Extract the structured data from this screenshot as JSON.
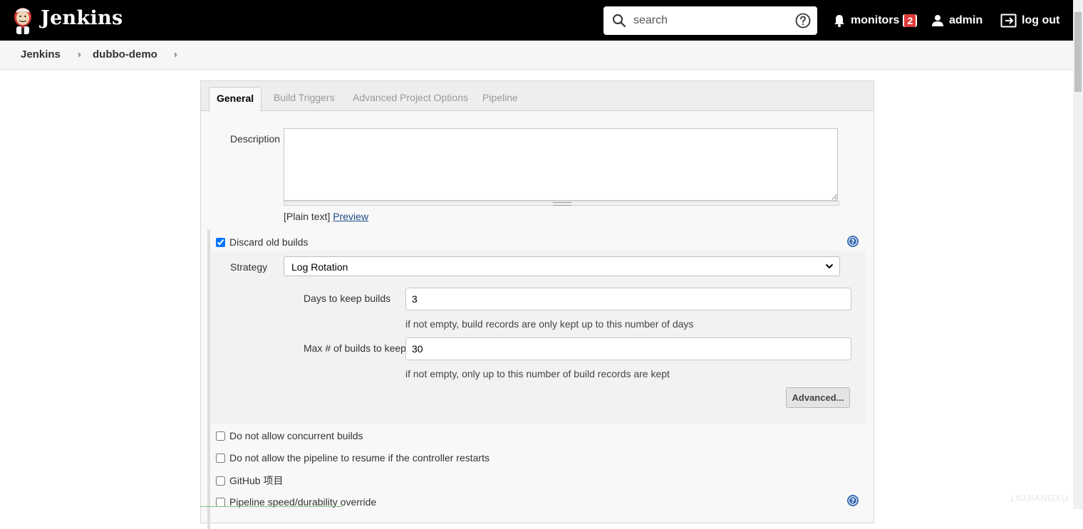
{
  "header": {
    "brand": "Jenkins",
    "search_placeholder": "search",
    "monitors_label": "monitors",
    "monitors_count": "2",
    "user_label": "admin",
    "logout_label": "log out"
  },
  "breadcrumb": {
    "items": [
      "Jenkins",
      "dubbo-demo"
    ]
  },
  "tabs": [
    {
      "label": "General",
      "active": true
    },
    {
      "label": "Build Triggers",
      "active": false
    },
    {
      "label": "Advanced Project Options",
      "active": false
    },
    {
      "label": "Pipeline",
      "active": false
    }
  ],
  "general": {
    "description_label": "Description",
    "description_value": "",
    "plain_text_label": "[Plain text]",
    "preview_link": "Preview",
    "discard_old_builds": {
      "label": "Discard old builds",
      "checked": true,
      "strategy_label": "Strategy",
      "strategy_value": "Log Rotation",
      "days_label": "Days to keep builds",
      "days_value": "3",
      "days_hint": "if not empty, build records are only kept up to this number of days",
      "max_label": "Max # of builds to keep",
      "max_value": "30",
      "max_hint": "if not empty, only up to this number of build records are kept",
      "advanced_button": "Advanced..."
    },
    "options": [
      {
        "label": "Do not allow concurrent builds",
        "checked": false
      },
      {
        "label": "Do not allow the pipeline to resume if the controller restarts",
        "checked": false
      },
      {
        "label": "GitHub 项目",
        "checked": false
      },
      {
        "label": "Pipeline speed/durability override",
        "checked": false
      }
    ]
  },
  "watermark": "LIUJIANGXU",
  "colors": {
    "header_bg": "#000000",
    "badge": "#e03a3a",
    "link": "#204a87",
    "help_icon": "#3c6eb4"
  }
}
